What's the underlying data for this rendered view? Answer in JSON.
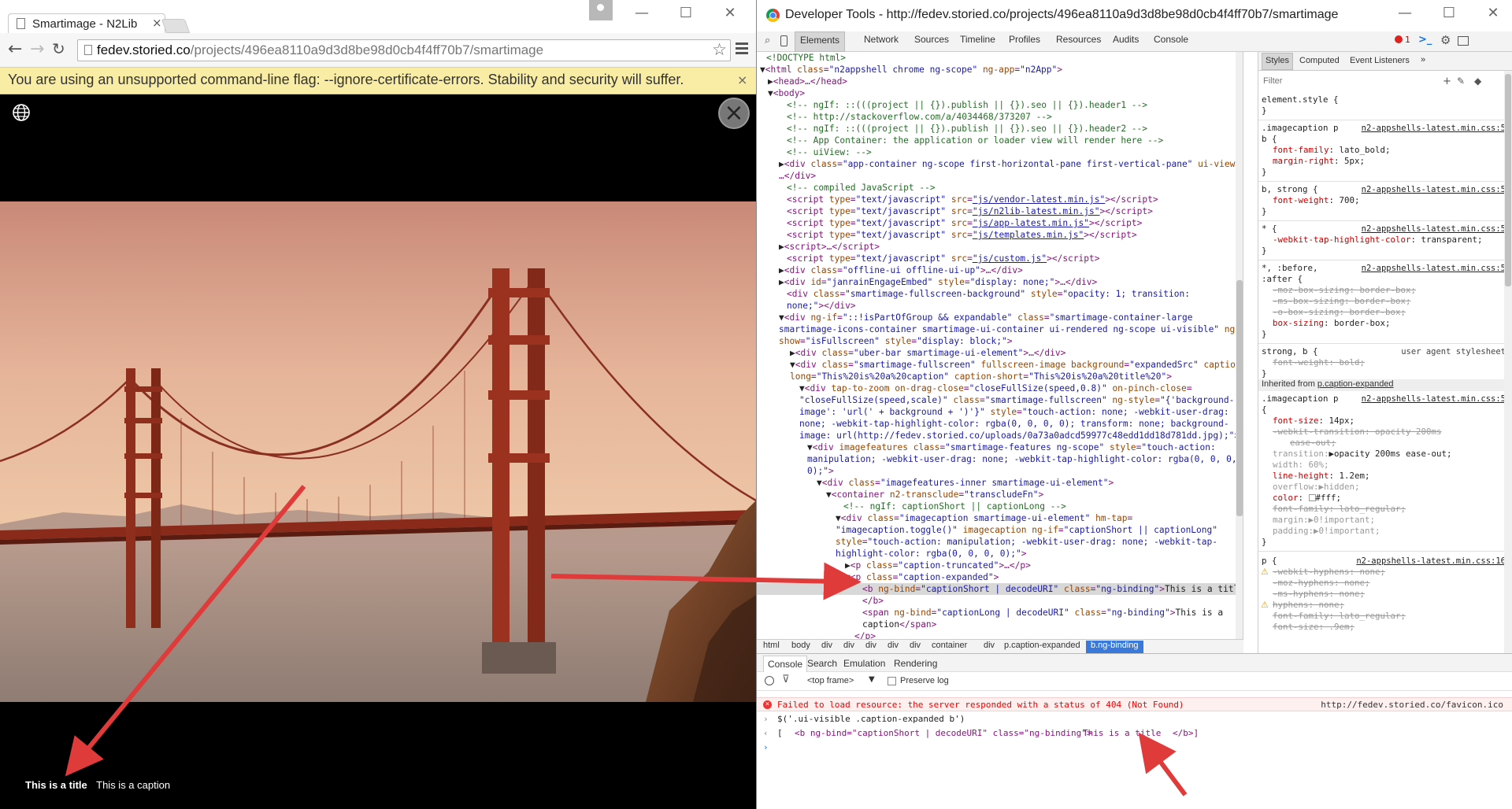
{
  "browser": {
    "tab_title": "Smartimage - N2Lib",
    "tab_close": "×",
    "url_host": "fedev.storied.co",
    "url_path": "/projects/496ea8110a9d3d8be98d0cb4f4ff70b7/smartimage",
    "infobar_message": "You are using an unsupported command-line flag: --ignore-certificate-errors. Stability and security will suffer.",
    "infobar_close": "×",
    "caption_title": "This is a title",
    "caption_text": "This is a caption",
    "window_controls": [
      "—",
      "☐",
      "✕"
    ]
  },
  "devtools": {
    "window_title": "Developer Tools - http://fedev.storied.co/projects/496ea8110a9d3d8be98d0cb4f4ff70b7/smartimage",
    "tabs": [
      "Elements",
      "Network",
      "Sources",
      "Timeline",
      "Profiles",
      "Resources",
      "Audits",
      "Console"
    ],
    "error_count": "1",
    "window_controls": [
      "—",
      "☐",
      "✕"
    ],
    "breadcrumbs": [
      "html",
      "body",
      "div",
      "div",
      "div",
      "div",
      "div",
      "container",
      "div",
      "p.caption-expanded",
      "b.ng-binding"
    ],
    "styles_tabs": [
      "Styles",
      "Computed",
      "Event Listeners",
      "»"
    ],
    "styles_filter_placeholder": "Filter",
    "console_tabs": [
      "Console",
      "Search",
      "Emulation",
      "Rendering"
    ],
    "console_frame": "<top frame>",
    "preserve_log": "Preserve log",
    "console_error": "Failed to load resource: the server responded with a status of 404 (Not Found)",
    "console_error_source": "http://fedev.storied.co/favicon.ico",
    "console_input": "$('.ui-visible .caption-expanded b')",
    "console_result_prefix": "[",
    "console_result_open": "<b ng-bind=\"captionShort | decodeURI\" class=\"ng-binding\">",
    "console_result_text": "This is a title ",
    "console_result_close": "</b>]"
  },
  "colors": {
    "selection": "#d8d8d8",
    "breadcrumb_active": "#3879d9",
    "infobar": "#f9eda6",
    "arrow": "#e03b3b"
  }
}
